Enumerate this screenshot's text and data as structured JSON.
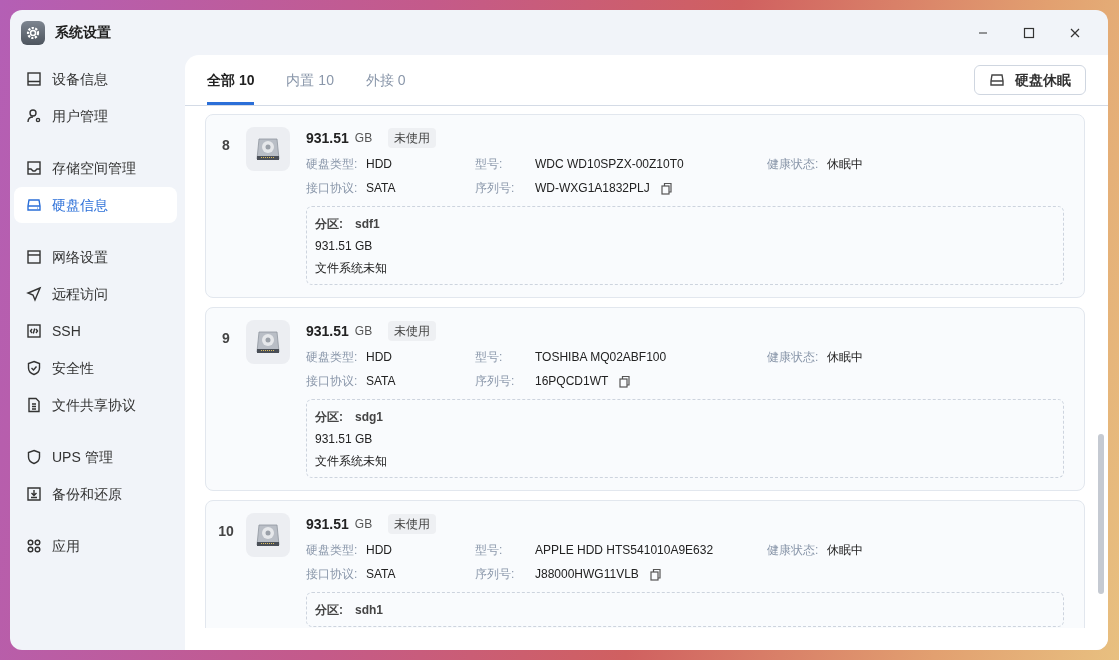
{
  "window": {
    "title": "系统设置"
  },
  "sidebar": {
    "groups": [
      [
        {
          "label": "设备信息",
          "selected": false
        },
        {
          "label": "用户管理",
          "selected": false
        }
      ],
      [
        {
          "label": "存储空间管理",
          "selected": false
        },
        {
          "label": "硬盘信息",
          "selected": true
        }
      ],
      [
        {
          "label": "网络设置",
          "selected": false
        },
        {
          "label": "远程访问",
          "selected": false
        },
        {
          "label": "SSH",
          "selected": false
        },
        {
          "label": "安全性",
          "selected": false
        },
        {
          "label": "文件共享协议",
          "selected": false
        }
      ],
      [
        {
          "label": "UPS 管理",
          "selected": false
        },
        {
          "label": "备份和还原",
          "selected": false
        }
      ],
      [
        {
          "label": "应用",
          "selected": false
        }
      ]
    ]
  },
  "tabs": [
    {
      "label": "全部",
      "count": "10",
      "selected": true
    },
    {
      "label": "内置",
      "count": "10",
      "selected": false
    },
    {
      "label": "外接",
      "count": "0",
      "selected": false
    }
  ],
  "sleep_button": {
    "label": "硬盘休眠"
  },
  "disks": [
    {
      "index": "8",
      "size": "931.51",
      "unit": "GB",
      "status": "未使用",
      "type_label": "硬盘类型:",
      "type": "HDD",
      "interface_label": "接口协议:",
      "interface": "SATA",
      "model_label": "型号:",
      "model": "WDC WD10SPZX-00Z10T0",
      "serial_label": "序列号:",
      "serial": "WD-WXG1A1832PLJ",
      "health_label": "健康状态:",
      "health": "休眠中",
      "partition": {
        "label": "分区:",
        "name": "sdf1",
        "size": "931.51 GB",
        "filesystem": "文件系统未知"
      }
    },
    {
      "index": "9",
      "size": "931.51",
      "unit": "GB",
      "status": "未使用",
      "type_label": "硬盘类型:",
      "type": "HDD",
      "interface_label": "接口协议:",
      "interface": "SATA",
      "model_label": "型号:",
      "model": "TOSHIBA MQ02ABF100",
      "serial_label": "序列号:",
      "serial": "16PQCD1WT",
      "health_label": "健康状态:",
      "health": "休眠中",
      "partition": {
        "label": "分区:",
        "name": "sdg1",
        "size": "931.51 GB",
        "filesystem": "文件系统未知"
      }
    },
    {
      "index": "10",
      "size": "931.51",
      "unit": "GB",
      "status": "未使用",
      "type_label": "硬盘类型:",
      "type": "HDD",
      "interface_label": "接口协议:",
      "interface": "SATA",
      "model_label": "型号:",
      "model": "APPLE HDD HTS541010A9E632",
      "serial_label": "序列号:",
      "serial": "J88000HWG11VLB",
      "health_label": "健康状态:",
      "health": "休眠中",
      "partition": {
        "label": "分区:",
        "name": "sdh1"
      }
    }
  ]
}
